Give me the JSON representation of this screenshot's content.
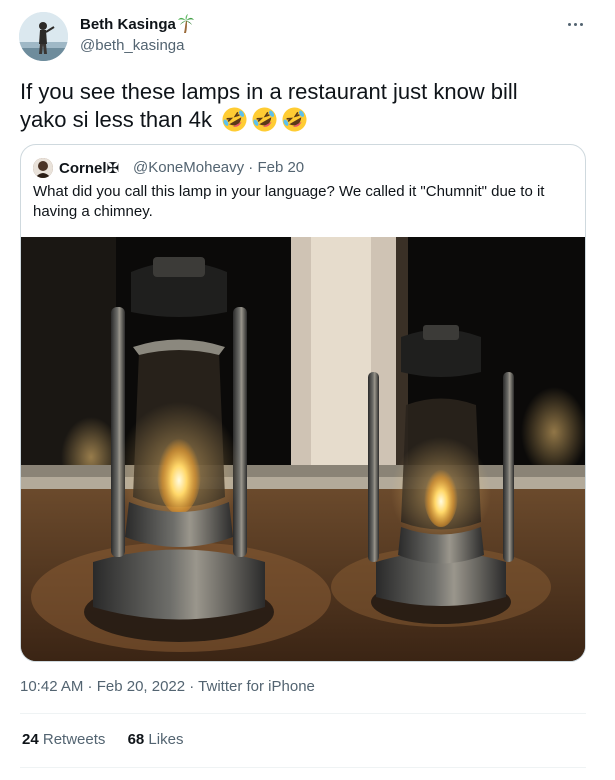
{
  "author": {
    "name": "Beth Kasinga",
    "handle": "@beth_kasinga",
    "name_emoji": "palm-tree"
  },
  "tweet": {
    "text": "If you see these lamps in a restaurant just know bill yako si less than 4k",
    "emojis": [
      "rolling-on-floor-laughing",
      "rolling-on-floor-laughing",
      "rolling-on-floor-laughing"
    ]
  },
  "quoted_tweet": {
    "name": "Cornel✠",
    "handle": "@KoneMoheavy · Feb 20",
    "text": "What did you call this lamp in your language? We called it \"Chumnit\" due to it having a chimney.",
    "image_description": "two-lit-hurricane-lamps"
  },
  "meta": {
    "timestamp": "10:42 AM · Feb 20, 2022 · Twitter for iPhone"
  },
  "stats": {
    "retweets_count": "24",
    "retweets_label": "Retweets",
    "likes_count": "68",
    "likes_label": "Likes"
  },
  "colors": {
    "primary_text": "#0f1419",
    "secondary_text": "#536471",
    "border": "#cfd9de",
    "divider": "#eff3f4"
  }
}
